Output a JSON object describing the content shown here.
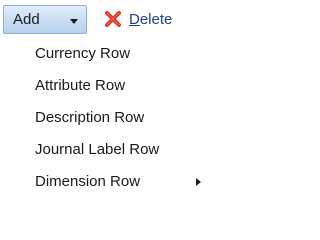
{
  "toolbar": {
    "add_label": "Add",
    "add_icon": "chevron-down-icon",
    "delete_label_first": "D",
    "delete_label_rest": "elete",
    "delete_icon": "red-x-icon",
    "delete_icon_color": "#d93025"
  },
  "menu": {
    "items": [
      {
        "label": "Currency Row",
        "has_submenu": false
      },
      {
        "label": "Attribute Row",
        "has_submenu": false
      },
      {
        "label": "Description Row",
        "has_submenu": false
      },
      {
        "label": "Journal Label Row",
        "has_submenu": false
      },
      {
        "label": "Dimension Row",
        "has_submenu": true,
        "submenu_icon": "chevron-right-icon"
      }
    ]
  }
}
